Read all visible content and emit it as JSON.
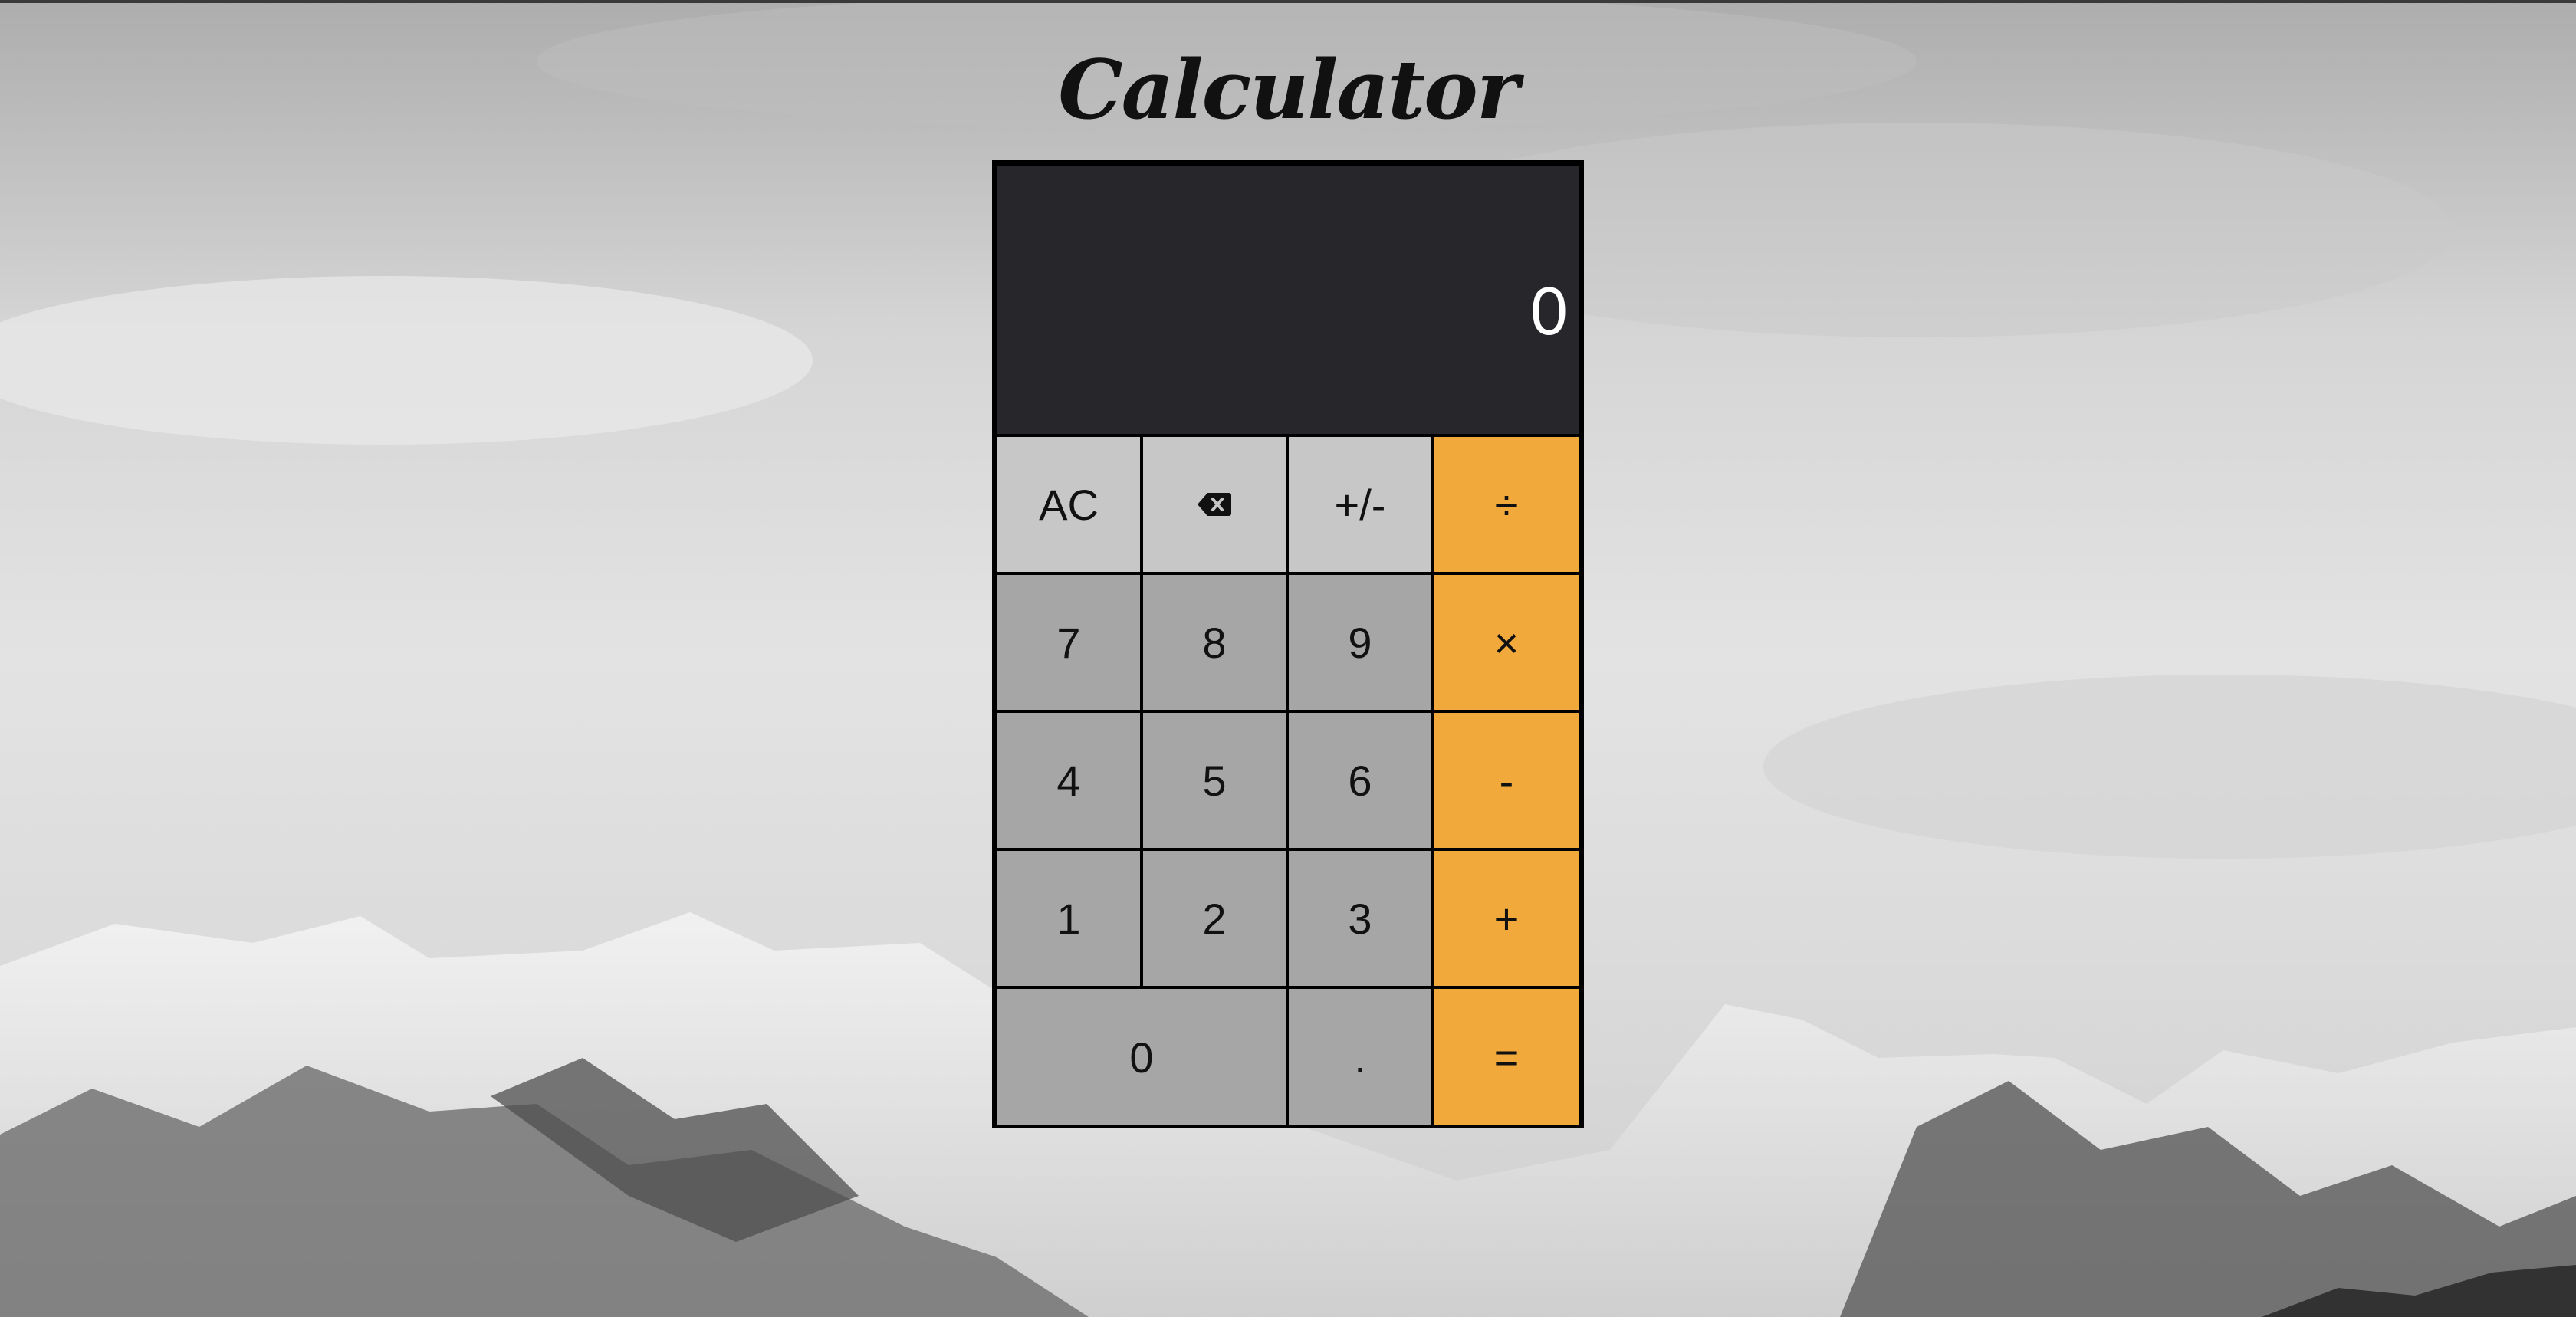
{
  "page": {
    "title": "Calculator"
  },
  "display": {
    "value": "0"
  },
  "keys": {
    "clear": "AC",
    "backspace_icon": "backspace-icon",
    "sign": "+/-",
    "divide": "÷",
    "seven": "7",
    "eight": "8",
    "nine": "9",
    "multiply": "×",
    "four": "4",
    "five": "5",
    "six": "6",
    "subtract": "-",
    "one": "1",
    "two": "2",
    "three": "3",
    "add": "+",
    "zero": "0",
    "decimal": ".",
    "equals": "="
  },
  "colors": {
    "display_bg": "#27262b",
    "function_key": "#c7c7c7",
    "number_key": "#a6a6a6",
    "operator_key": "#f0a93a"
  }
}
